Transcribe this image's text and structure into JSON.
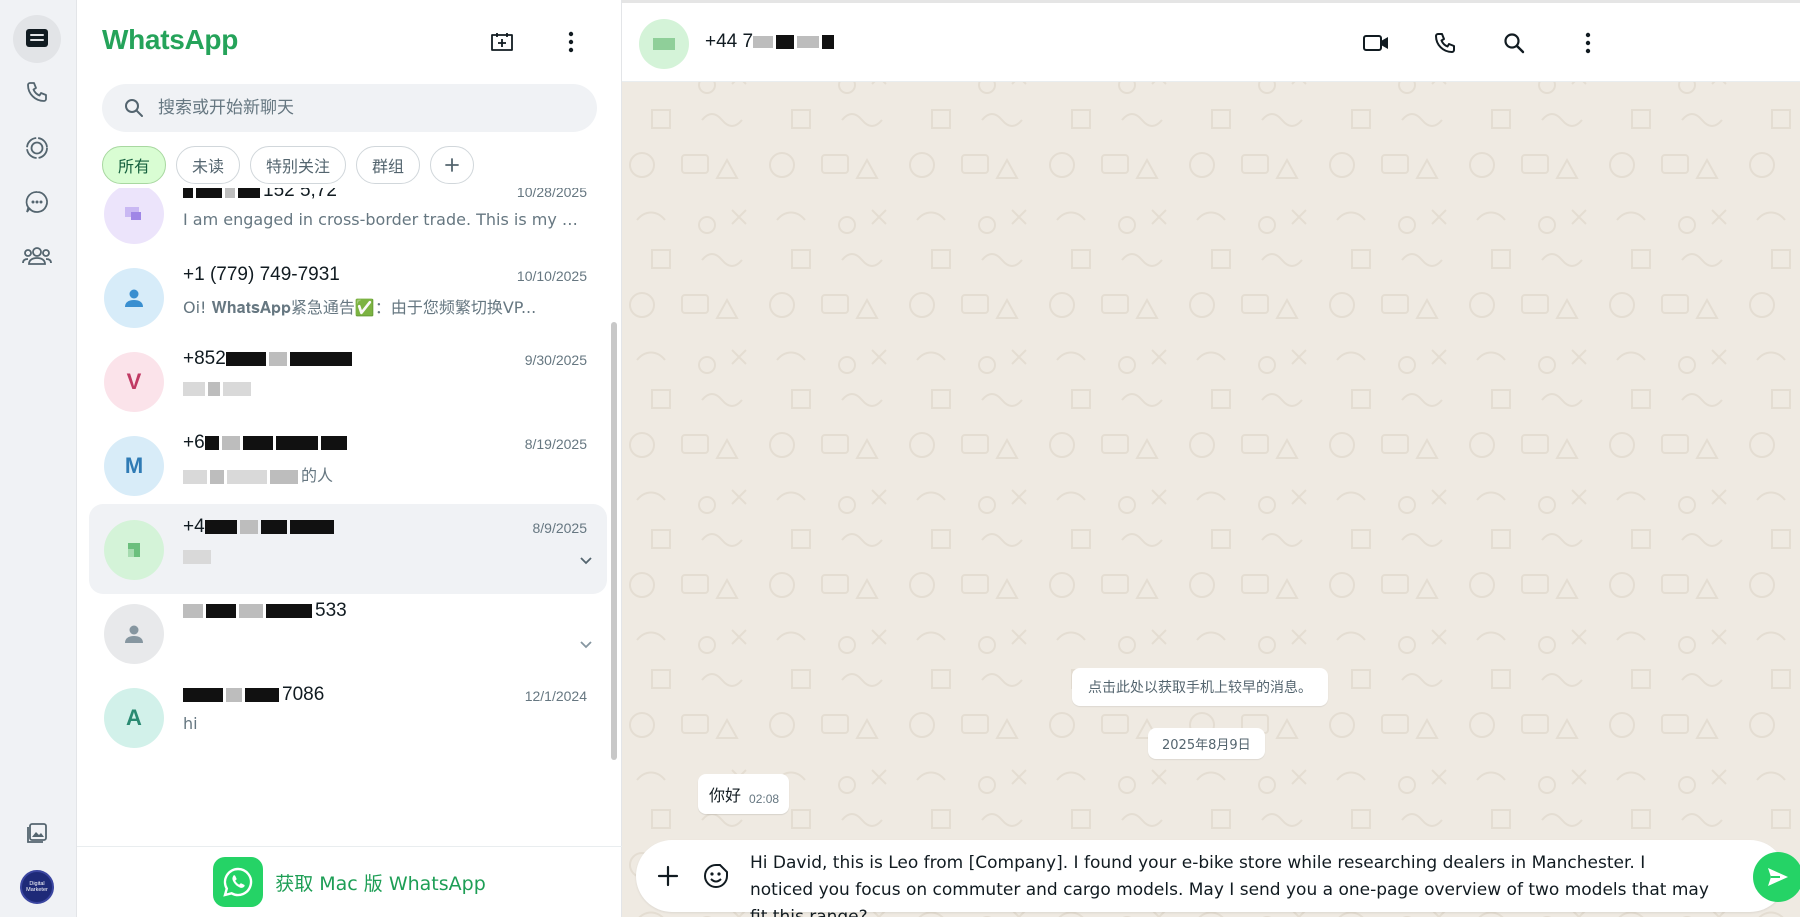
{
  "app": {
    "title": "WhatsApp"
  },
  "colors": {
    "brand_green": "#25d366",
    "title_green": "#25a35a",
    "chip_active_bg": "#d9fdd3",
    "chat_bg": "#efeae2"
  },
  "rail": {
    "items": [
      {
        "icon": "chats-icon",
        "active": true
      },
      {
        "icon": "phone-icon",
        "active": false
      },
      {
        "icon": "status-icon",
        "active": false
      },
      {
        "icon": "channels-icon",
        "active": false
      },
      {
        "icon": "communities-icon",
        "active": false
      }
    ],
    "bottom": [
      {
        "icon": "media-icon"
      }
    ],
    "profile_avatar_text": "Digital Marketer"
  },
  "header": {
    "new_chat_icon": "new-chat-icon",
    "menu_icon": "more-vertical-icon"
  },
  "search": {
    "placeholder": "搜索或开始新聊天"
  },
  "filters": {
    "items": [
      "所有",
      "未读",
      "特别关注",
      "群组"
    ],
    "active": "所有"
  },
  "chats": [
    {
      "name_visible": "152 5,72",
      "date": "10/28/2025",
      "preview": "I am engaged in cross-border trade. This is my w...",
      "avatar_color": "#ece4fb",
      "avatar_text": ""
    },
    {
      "name_visible": "+1 (779) 749-7931",
      "date": "10/10/2025",
      "preview": "Oi!  𝐖𝐡𝐚𝐭𝐬𝐀𝐩𝐩紧急通告✅：由于您频繁切换VP...",
      "avatar_color": "#d7ecf9",
      "avatar_text": ""
    },
    {
      "name_visible": "+852",
      "date": "9/30/2025",
      "preview": "",
      "avatar_color": "#fbe3ea",
      "avatar_text": "V"
    },
    {
      "name_visible": "+6",
      "date": "8/19/2025",
      "preview": "的人",
      "avatar_color": "#d8ecf8",
      "avatar_text": "M"
    },
    {
      "name_visible": "+4",
      "date": "8/9/2025",
      "preview": "",
      "avatar_color": "#d4f3d8",
      "avatar_text": ""
    },
    {
      "name_visible": "533",
      "date": "",
      "preview": "",
      "avatar_color": "#e8e9eb",
      "avatar_text": ""
    },
    {
      "name_visible": "7086",
      "date": "12/1/2024",
      "preview": "hi",
      "avatar_color": "#d2f1ea",
      "avatar_text": "A"
    }
  ],
  "mac_banner": {
    "text": "获取 Mac 版 WhatsApp"
  },
  "conversation": {
    "contact_visible": "+44 7",
    "header_icons": [
      "video-call-icon",
      "phone-icon",
      "search-icon",
      "more-vertical-icon"
    ],
    "notice": "点击此处以获取手机上较早的消息。",
    "date_divider": "2025年8月9日",
    "messages": [
      {
        "text": "你好",
        "time": "02:08",
        "direction": "incoming"
      }
    ],
    "composer_text": "Hi David, this is Leo from [Company]. I found your e-bike store while researching dealers in Manchester. I noticed you focus on commuter and cargo models. May I send you a one-page overview of two models that may fit this range?"
  }
}
